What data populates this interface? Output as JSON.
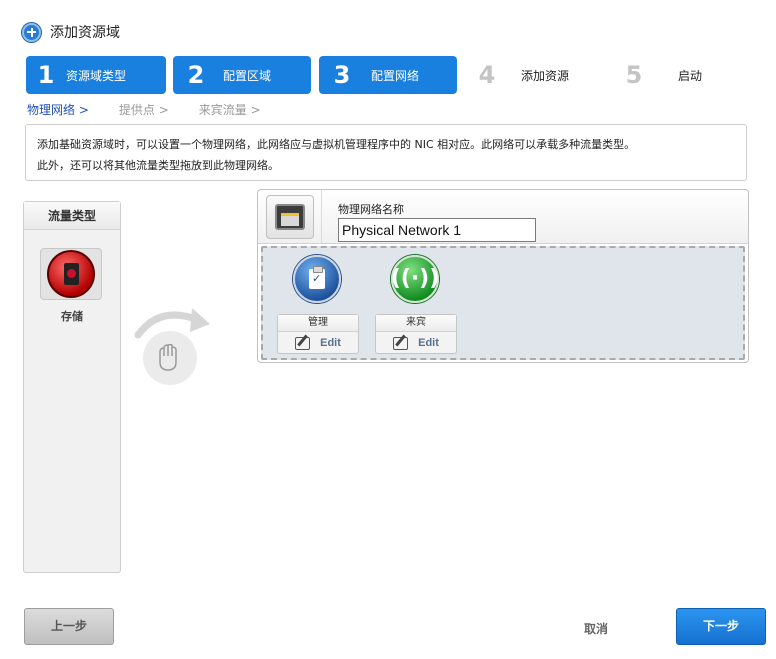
{
  "title": "添加资源域",
  "steps": [
    {
      "num": "1",
      "label": "资源域类型"
    },
    {
      "num": "2",
      "label": "配置区域"
    },
    {
      "num": "3",
      "label": "配置网络"
    },
    {
      "num": "4",
      "label": "添加资源"
    },
    {
      "num": "5",
      "label": "启动"
    }
  ],
  "subnav": {
    "current": "物理网络 >",
    "item2": "提供点 >",
    "item3": "来宾流量 >"
  },
  "description": {
    "line1": "添加基础资源域时，可以设置一个物理网络，此网络应与虚拟机管理程序中的 NIC 相对应。此网络可以承载多种流量类型。",
    "line2": "此外，还可以将其他流量类型拖放到此物理网络。"
  },
  "traffic_panel": {
    "header": "流量类型",
    "storage_label": "存储"
  },
  "network": {
    "name_label": "物理网络名称",
    "name_value": "Physical Network 1",
    "traffic": [
      {
        "label": "管理",
        "edit": "Edit"
      },
      {
        "label": "来宾",
        "edit": "Edit"
      }
    ]
  },
  "buttons": {
    "back": "上一步",
    "cancel": "取消",
    "next": "下一步"
  },
  "colors": {
    "accent": "#1a80e0",
    "storage": "#c8102e",
    "management": "#1c4f9a",
    "guest": "#0f8a1f"
  }
}
